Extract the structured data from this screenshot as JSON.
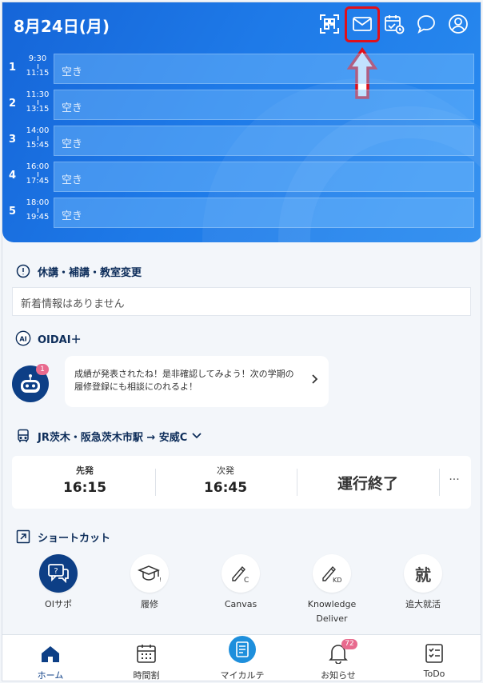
{
  "header": {
    "date": "8月24日(月)",
    "icons": [
      "qr-code-icon",
      "mail-icon",
      "calendar-clock-icon",
      "chat-icon",
      "user-icon"
    ]
  },
  "periods": [
    {
      "num": "1",
      "start": "9:30",
      "end": "11:15",
      "label": "空き"
    },
    {
      "num": "2",
      "start": "11:30",
      "end": "13:15",
      "label": "空き"
    },
    {
      "num": "3",
      "start": "14:00",
      "end": "15:45",
      "label": "空き"
    },
    {
      "num": "4",
      "start": "16:00",
      "end": "17:45",
      "label": "空き"
    },
    {
      "num": "5",
      "start": "18:00",
      "end": "19:45",
      "label": "空き"
    }
  ],
  "notices": {
    "title": "休講・補講・教室変更",
    "empty_text": "新着情報はありません"
  },
  "ai": {
    "title": "OIDAI＋",
    "badge": "1",
    "message": "成績が発表されたね！是非確認してみよう！次の学期の履修登録にも相談にのれるよ！"
  },
  "bus": {
    "route": "JR茨木・阪急茨木市駅 → 安威C",
    "first_label": "先発",
    "first_time": "16:15",
    "next_label": "次発",
    "next_time": "16:45",
    "status": "運行終了",
    "more": "···"
  },
  "shortcuts": {
    "title": "ショートカット",
    "items": [
      {
        "label": "OIサポ",
        "icon": "support-chat-icon"
      },
      {
        "label": "履修",
        "icon": "graduation-cap-icon"
      },
      {
        "label": "Canvas",
        "icon": "canvas-pen-icon"
      },
      {
        "label": "Knowledge\nDeliver",
        "icon": "knowledge-deliver-icon"
      },
      {
        "label": "追大就活",
        "icon": "job-hunting-icon",
        "glyph": "就"
      }
    ]
  },
  "tabs": [
    {
      "label": "ホーム",
      "icon": "home-icon"
    },
    {
      "label": "時間割",
      "icon": "timetable-icon"
    },
    {
      "label": "マイカルテ",
      "icon": "my-karte-icon"
    },
    {
      "label": "お知らせ",
      "icon": "bell-icon",
      "badge": "72"
    },
    {
      "label": "ToDo",
      "icon": "todo-icon"
    }
  ],
  "colors": {
    "accent": "#1565d8",
    "navy": "#0d3f86",
    "highlight": "#e0101b",
    "badge": "#e86a8e"
  }
}
